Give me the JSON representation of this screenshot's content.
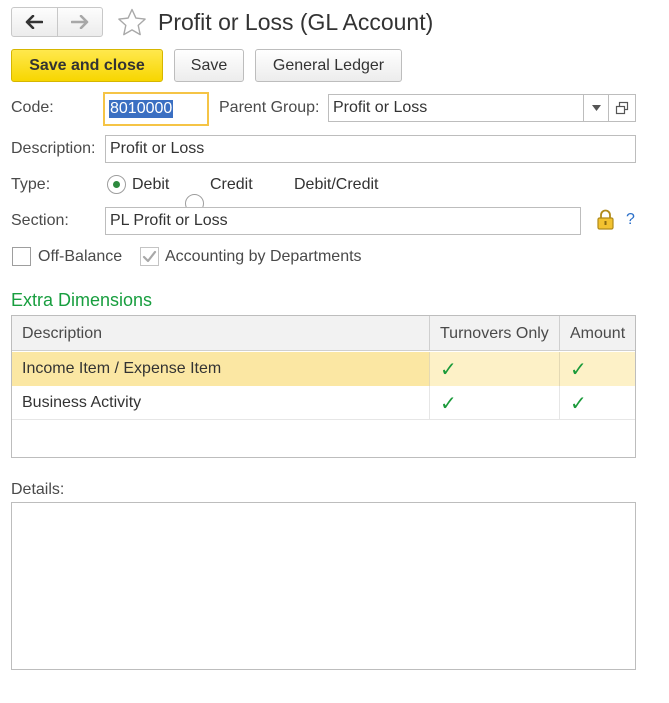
{
  "window": {
    "title": "Profit or Loss (GL Account)"
  },
  "toolbar": {
    "save_and_close_label": "Save and close",
    "save_label": "Save",
    "general_ledger_label": "General Ledger"
  },
  "form": {
    "code_label": "Code:",
    "code_value": "8010000",
    "parent_group_label": "Parent Group:",
    "parent_group_value": "Profit or Loss",
    "description_label": "Description:",
    "description_value": "Profit or Loss",
    "type_label": "Type:",
    "type_options": [
      {
        "label": "Debit",
        "checked": true
      },
      {
        "label": "Credit",
        "checked": false
      },
      {
        "label": "Debit/Credit",
        "checked": false
      }
    ],
    "section_label": "Section:",
    "section_value": "PL Profit or Loss",
    "help_mark": "?",
    "off_balance_label": "Off-Balance",
    "accounting_by_departments_label": "Accounting by Departments"
  },
  "extra_dimensions": {
    "title": "Extra Dimensions",
    "columns": [
      "Description",
      "Turnovers Only",
      "Amount"
    ],
    "rows": [
      {
        "description": "Income Item / Expense Item",
        "turnovers_only": true,
        "amount": true,
        "selected": true
      },
      {
        "description": "Business Activity",
        "turnovers_only": true,
        "amount": true,
        "selected": false
      }
    ],
    "check_glyph": "✓"
  },
  "details": {
    "label": "Details:",
    "value": ""
  },
  "colors": {
    "primary_button": "#f7d600",
    "section_title": "#189e3f",
    "selected_row": "#fbe7a3",
    "check": "#1a9a3a",
    "focus_border": "#f5c446"
  },
  "icons": {
    "back": "arrow-left-icon",
    "forward": "arrow-right-icon",
    "favorite": "star-icon",
    "dropdown": "chevron-down-icon",
    "open": "open-window-icon",
    "lock": "lock-icon",
    "help": "help-icon"
  }
}
